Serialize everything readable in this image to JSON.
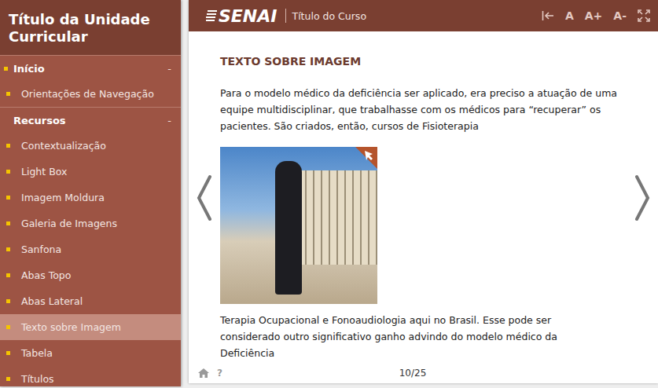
{
  "sidebar": {
    "title": "Título da Unidade Curricular",
    "sections": [
      {
        "label": "Início",
        "toggle": "-",
        "bullet": true,
        "items": [
          {
            "label": "Orientações de Navegação",
            "selected": false
          }
        ]
      },
      {
        "label": "Recursos",
        "toggle": "-",
        "bullet": false,
        "items": [
          {
            "label": "Contextualização",
            "selected": false
          },
          {
            "label": "Light Box",
            "selected": false
          },
          {
            "label": "Imagem Moldura",
            "selected": false
          },
          {
            "label": "Galeria de Imagens",
            "selected": false
          },
          {
            "label": "Sanfona",
            "selected": false
          },
          {
            "label": "Abas Topo",
            "selected": false
          },
          {
            "label": "Abas Lateral",
            "selected": false
          },
          {
            "label": "Texto sobre Imagem",
            "selected": true
          },
          {
            "label": "Tabela",
            "selected": false
          },
          {
            "label": "Títulos",
            "selected": false
          }
        ]
      }
    ]
  },
  "header": {
    "logo": "SENAI",
    "course_title": "Título do Curso",
    "font_tools": [
      "A",
      "A+",
      "A-"
    ]
  },
  "content": {
    "heading": "TEXTO SOBRE IMAGEM",
    "paragraph_before": "Para o modelo médico da deficiência ser aplicado, era preciso a atuação de uma equipe multidisciplinar, que trabalhasse com os médicos para “recuperar” os pacientes. São criados, então, cursos de Fisioterapia",
    "paragraph_after": "Terapia Ocupacional e Fonoaudiologia aqui no Brasil. Esse pode ser considerado outro significativo ganho advindo do modelo médico da Deficiência"
  },
  "footer": {
    "help": "?",
    "page": "10/25"
  }
}
